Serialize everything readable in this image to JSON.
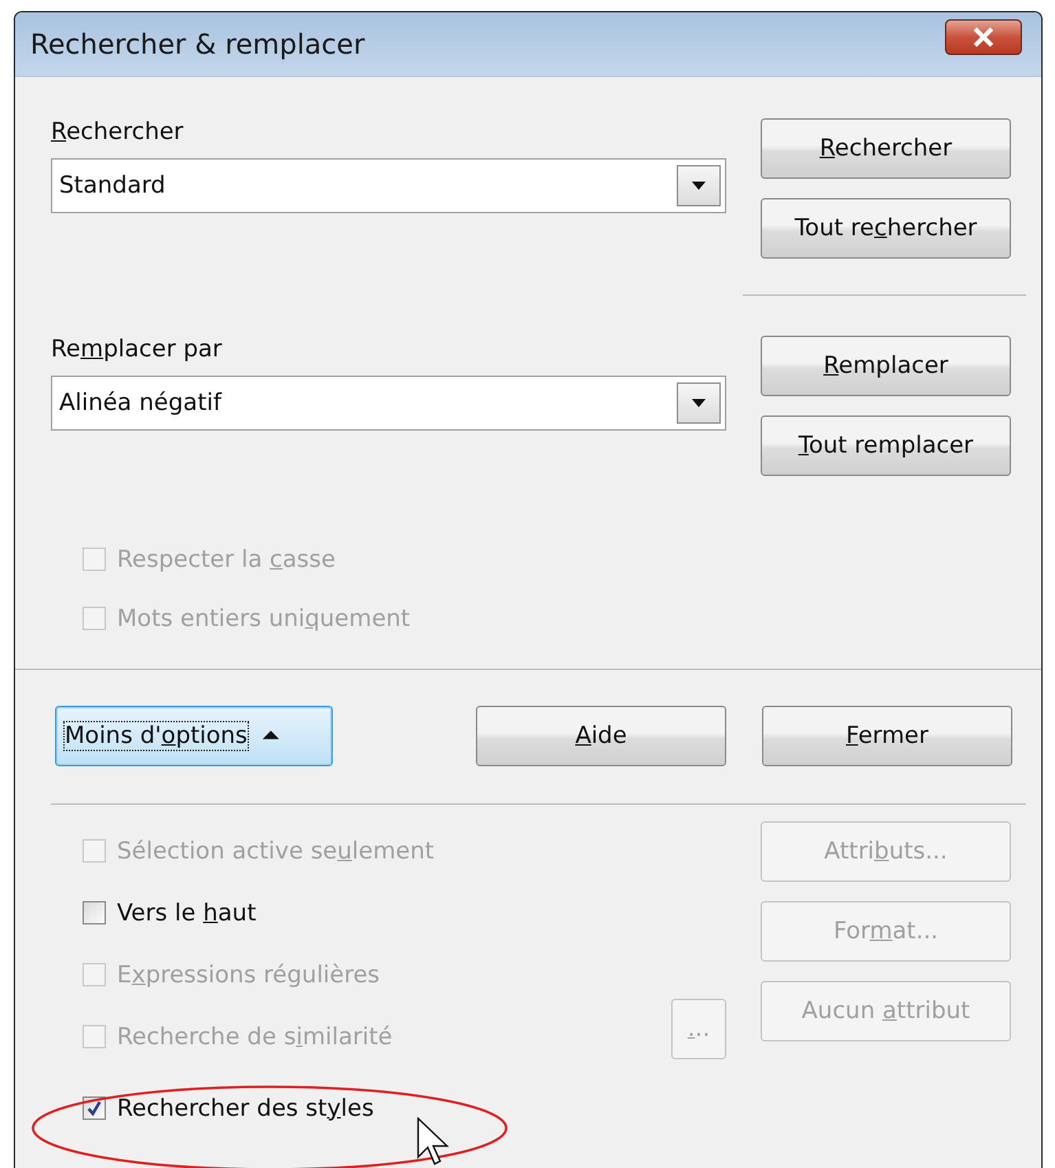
{
  "window": {
    "title": "Rechercher & remplacer"
  },
  "search": {
    "label": {
      "key": "R",
      "post": "echercher"
    },
    "value": "Standard"
  },
  "search_buttons": [
    {
      "label": {
        "key": "R",
        "post": "echercher"
      },
      "disabled": false
    },
    {
      "label": {
        "pre": "Tout re",
        "key": "c",
        "post": "hercher"
      },
      "disabled": false
    }
  ],
  "replace": {
    "label": {
      "pre": "Re",
      "key": "m",
      "post": "placer par"
    },
    "value": "Alinéa négatif"
  },
  "replace_buttons": [
    {
      "label": {
        "key": "R",
        "post": "emplacer"
      },
      "disabled": false
    },
    {
      "label": {
        "key": "T",
        "post": "out remplacer"
      },
      "disabled": false
    }
  ],
  "options": [
    {
      "label": {
        "pre": "Respecter la ",
        "key": "c",
        "post": "asse"
      },
      "checked": false,
      "disabled": true
    },
    {
      "label": {
        "pre": "Mots entiers uni",
        "key": "q",
        "post": "uement"
      },
      "checked": false,
      "disabled": true
    }
  ],
  "footer_buttons": [
    {
      "label": {
        "pre": "Moins d'",
        "key": "o",
        "post": "ptions"
      },
      "focused": true,
      "disabled": false,
      "expander": "⏶"
    },
    {
      "label": {
        "key": "A",
        "post": "ide"
      },
      "focused": false,
      "disabled": false
    },
    {
      "label": {
        "key": "F",
        "post": "ermer"
      },
      "focused": false,
      "disabled": false
    }
  ],
  "more_options": [
    {
      "label": {
        "pre": "Sélection active se",
        "key": "u",
        "post": "lement"
      },
      "checked": false,
      "disabled": true
    },
    {
      "label": {
        "pre": "Vers le ",
        "key": "h",
        "post": "aut"
      },
      "checked": false,
      "disabled": false
    },
    {
      "label": {
        "pre": "E",
        "key": "x",
        "post": "pressions régulières"
      },
      "checked": false,
      "disabled": true
    },
    {
      "label": {
        "pre": "Recherche de s",
        "key": "i",
        "post": "milarité"
      },
      "checked": false,
      "disabled": true,
      "settings_button": {
        "label": {
          "key": ".",
          "post": ".."
        },
        "disabled": true
      }
    },
    {
      "label": {
        "pre": "Rechercher des st",
        "key": "y",
        "post": "les"
      },
      "checked": true,
      "disabled": false,
      "highlighted": true
    }
  ],
  "attribute_buttons": [
    {
      "label": {
        "pre": "Attri",
        "key": "b",
        "post": "uts..."
      },
      "disabled": true
    },
    {
      "label": {
        "pre": "For",
        "key": "m",
        "post": "at..."
      },
      "disabled": true
    },
    {
      "label": {
        "pre": "Aucun ",
        "key": "a",
        "post": "ttribut"
      },
      "disabled": true
    }
  ]
}
